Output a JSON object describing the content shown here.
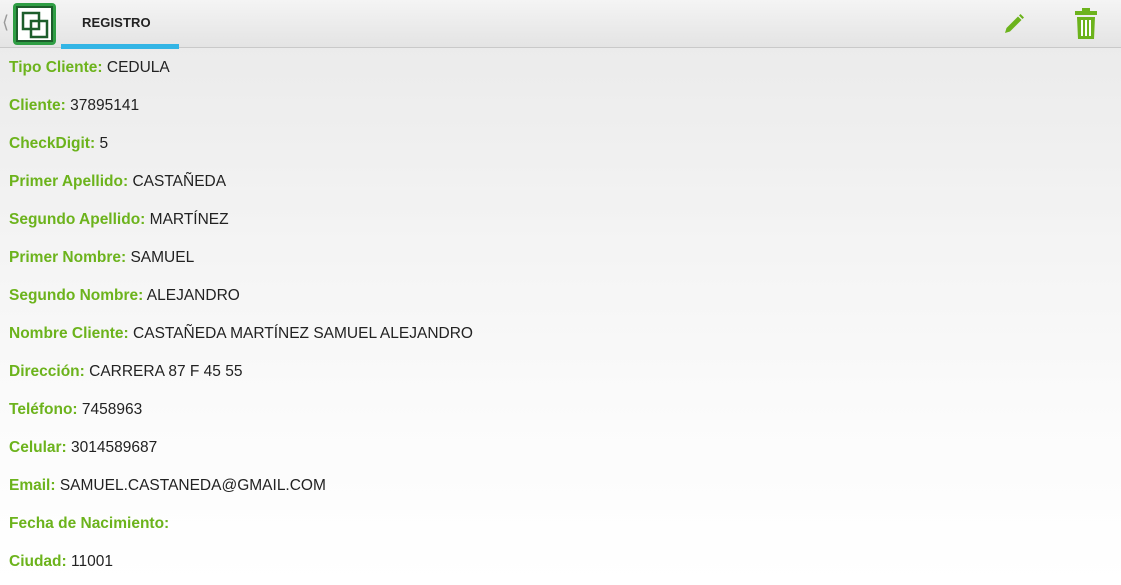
{
  "actionbar": {
    "tab_label": "REGISTRO",
    "icons": {
      "app": "app-logo-icon",
      "edit": "pencil-icon",
      "delete": "trash-icon"
    },
    "colors": {
      "accent": "#6cb31c",
      "tab_indicator": "#33b5e5",
      "app_icon": "#2f9e44"
    }
  },
  "fields": [
    {
      "label": "Tipo Cliente:",
      "value": "CEDULA"
    },
    {
      "label": "Cliente:",
      "value": "37895141"
    },
    {
      "label": "CheckDigit:",
      "value": "5"
    },
    {
      "label": "Primer Apellido:",
      "value": "CASTAÑEDA"
    },
    {
      "label": "Segundo Apellido:",
      "value": "MARTÍNEZ"
    },
    {
      "label": "Primer Nombre:",
      "value": "SAMUEL"
    },
    {
      "label": "Segundo Nombre:",
      "value": "ALEJANDRO"
    },
    {
      "label": "Nombre Cliente:",
      "value": "CASTAÑEDA MARTÍNEZ SAMUEL ALEJANDRO"
    },
    {
      "label": "Dirección:",
      "value": "CARRERA 87 F 45 55"
    },
    {
      "label": "Teléfono:",
      "value": "7458963"
    },
    {
      "label": "Celular:",
      "value": "3014589687"
    },
    {
      "label": "Email:",
      "value": "SAMUEL.CASTANEDA@GMAIL.COM"
    },
    {
      "label": "Fecha de Nacimiento:",
      "value": ""
    },
    {
      "label": "Ciudad:",
      "value": "11001"
    }
  ]
}
